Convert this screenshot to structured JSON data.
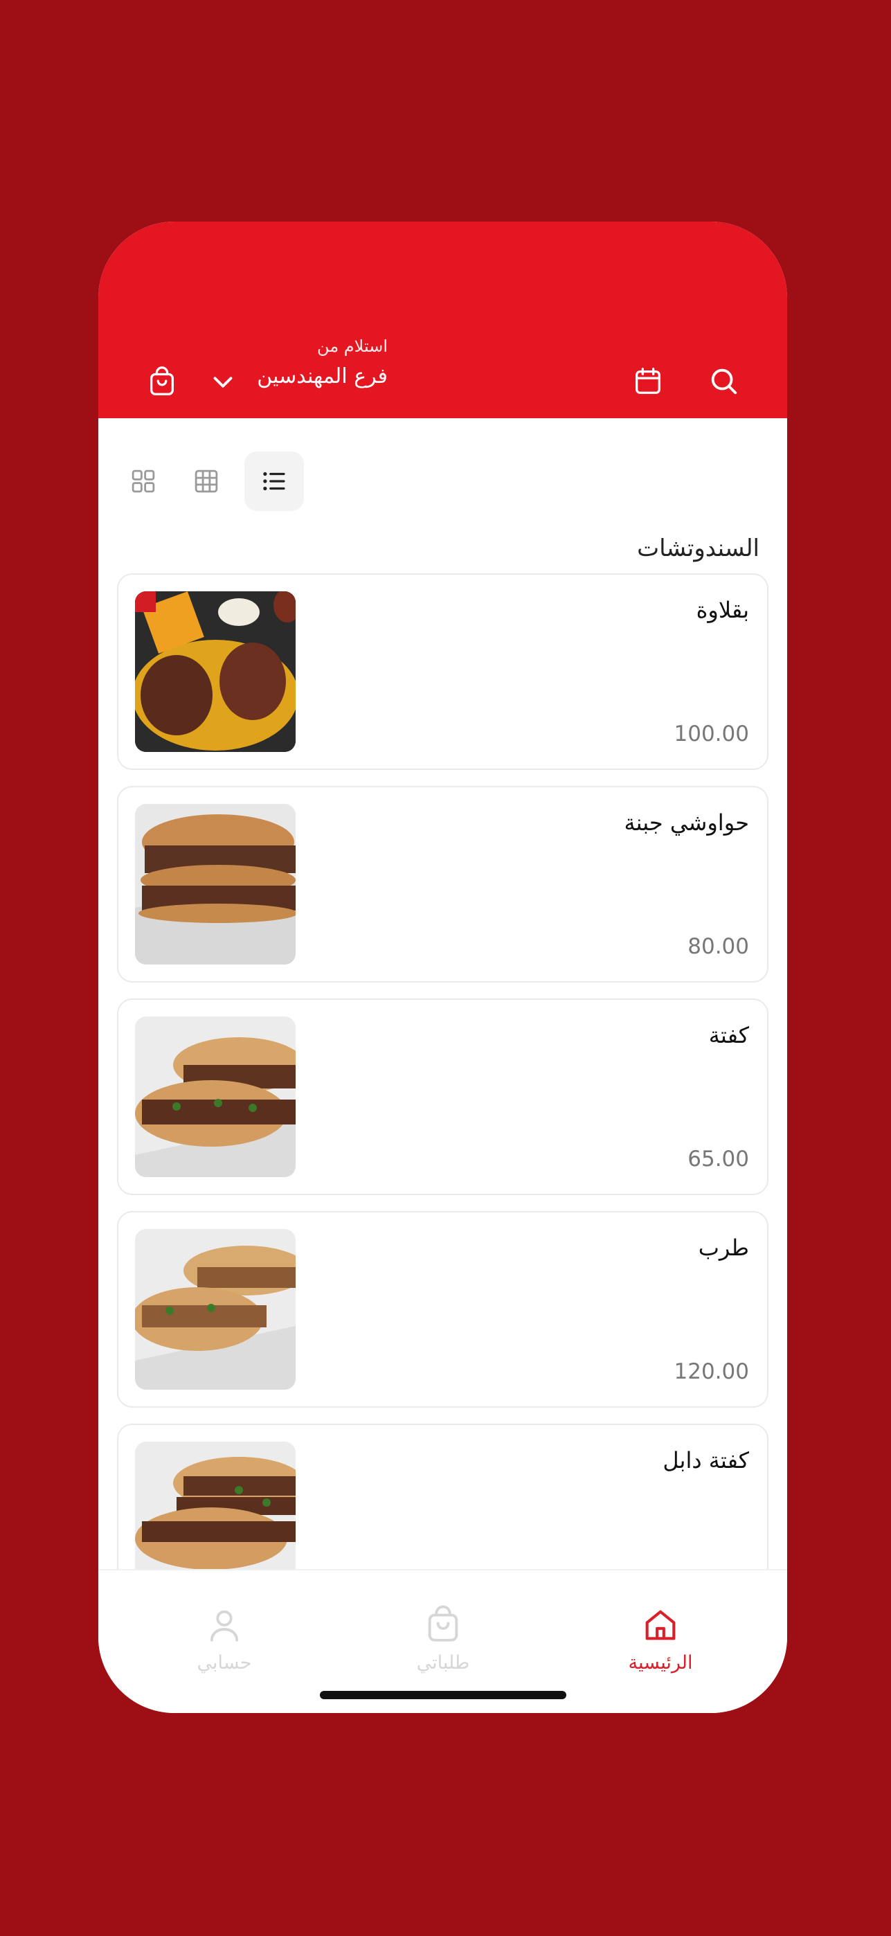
{
  "header": {
    "pickup_label": "استلام من",
    "branch_name": "فرع المهندسين"
  },
  "section": {
    "title": "السندوتشات"
  },
  "products": [
    {
      "name": "بقلاوة",
      "price": "100.00"
    },
    {
      "name": "حواوشي جبنة",
      "price": "80.00"
    },
    {
      "name": "كفتة",
      "price": "65.00"
    },
    {
      "name": "طرب",
      "price": "120.00"
    },
    {
      "name": "كفتة دابل",
      "price": ""
    }
  ],
  "tabs": {
    "home": "الرئيسية",
    "orders": "طلباتي",
    "account": "حسابي"
  },
  "colors": {
    "brand": "#e41622",
    "background": "#9e0e15",
    "active_tab": "#d8202b",
    "inactive_tab": "#d6d6d6"
  },
  "view_modes": {
    "selected": "list-view",
    "options": [
      "list-view",
      "grid-3-view",
      "grid-2-view"
    ]
  }
}
